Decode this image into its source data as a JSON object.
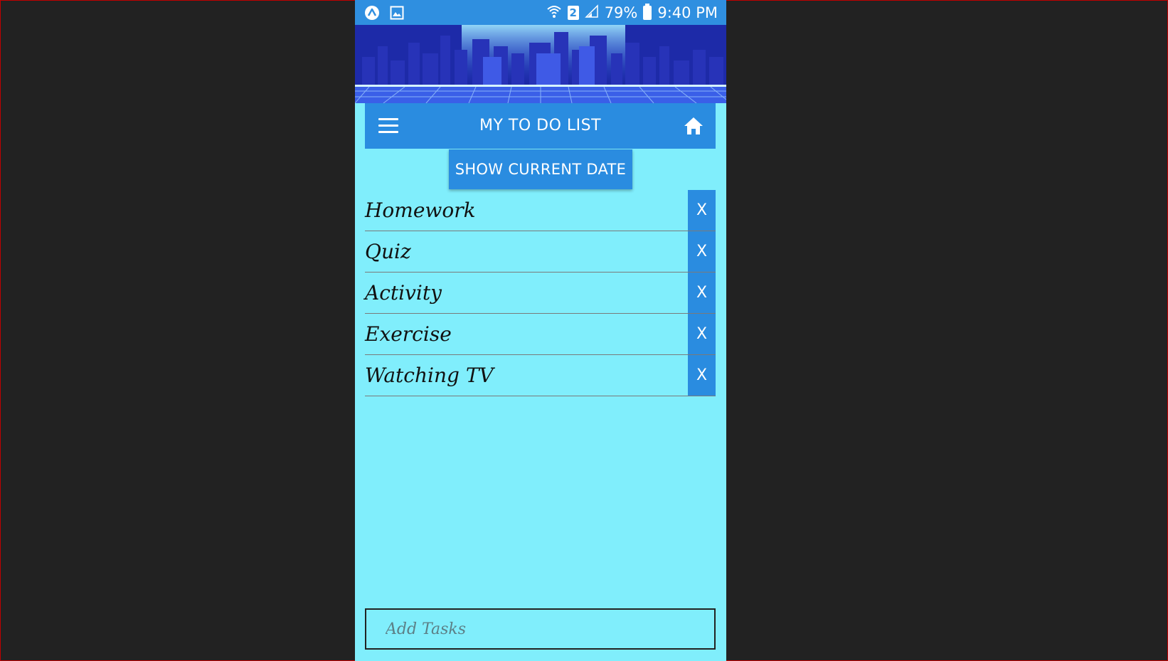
{
  "status_bar": {
    "left_icons": [
      "app-logo-icon",
      "image-icon"
    ],
    "sim_label": "2",
    "battery_percent": "79%",
    "time": "9:40 PM"
  },
  "toolbar": {
    "title": "MY TO DO LIST"
  },
  "actions": {
    "show_date_label": "SHOW CURRENT DATE"
  },
  "tasks": [
    {
      "label": "Homework",
      "delete_label": "X"
    },
    {
      "label": "Quiz",
      "delete_label": "X"
    },
    {
      "label": "Activity",
      "delete_label": "X"
    },
    {
      "label": "Exercise",
      "delete_label": "X"
    },
    {
      "label": "Watching TV",
      "delete_label": "X"
    }
  ],
  "add_task": {
    "placeholder": "Add Tasks",
    "value": ""
  },
  "colors": {
    "app_background": "#80eefc",
    "primary": "#2a8ce0",
    "status_bar": "#2f8fe0",
    "outer_background": "#222222"
  }
}
